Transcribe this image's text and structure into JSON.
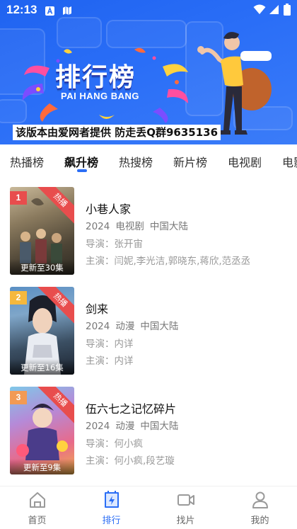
{
  "status_bar": {
    "time": "12:13"
  },
  "banner": {
    "title": "排行榜",
    "subtitle": "PAI HANG BANG",
    "notice": "该版本由爱网者提供 防走丢Q群9635136"
  },
  "tabs": [
    {
      "label": "热播榜",
      "active": false
    },
    {
      "label": "飙升榜",
      "active": true
    },
    {
      "label": "热搜榜",
      "active": false
    },
    {
      "label": "新片榜",
      "active": false
    },
    {
      "label": "电视剧",
      "active": false
    },
    {
      "label": "电影",
      "active": false
    }
  ],
  "items": [
    {
      "rank": "1",
      "badge": "热播",
      "update": "更新至30集",
      "title": "小巷人家",
      "year": "2024",
      "genre": "电视剧",
      "region": "中国大陆",
      "director_label": "导演：",
      "director": "张开宙",
      "cast_label": "主演：",
      "cast": "闫妮,李光洁,郭晓东,蒋欣,范丞丞",
      "rank_color": "#e84d4d"
    },
    {
      "rank": "2",
      "badge": "热播",
      "update": "更新至16集",
      "title": "剑来",
      "year": "2024",
      "genre": "动漫",
      "region": "中国大陆",
      "director_label": "导演：",
      "director": "内详",
      "cast_label": "主演：",
      "cast": "内详",
      "rank_color": "#f5b83d"
    },
    {
      "rank": "3",
      "badge": "热播",
      "update": "更新至9集",
      "title": "伍六七之记忆碎片",
      "year": "2024",
      "genre": "动漫",
      "region": "中国大陆",
      "director_label": "导演：",
      "director": "何小疯",
      "cast_label": "主演：",
      "cast": "何小疯,段艺璇",
      "rank_color": "#f29a54"
    }
  ],
  "bottom_nav": [
    {
      "label": "首页",
      "icon": "home-icon",
      "active": false
    },
    {
      "label": "排行",
      "icon": "rank-icon",
      "active": true
    },
    {
      "label": "找片",
      "icon": "video-camera-icon",
      "active": false
    },
    {
      "label": "我的",
      "icon": "user-icon",
      "active": false
    }
  ],
  "colors": {
    "accent": "#2b6ef5",
    "banner_blue": "#2a6ef7",
    "badge_red": "#e84d4d"
  }
}
